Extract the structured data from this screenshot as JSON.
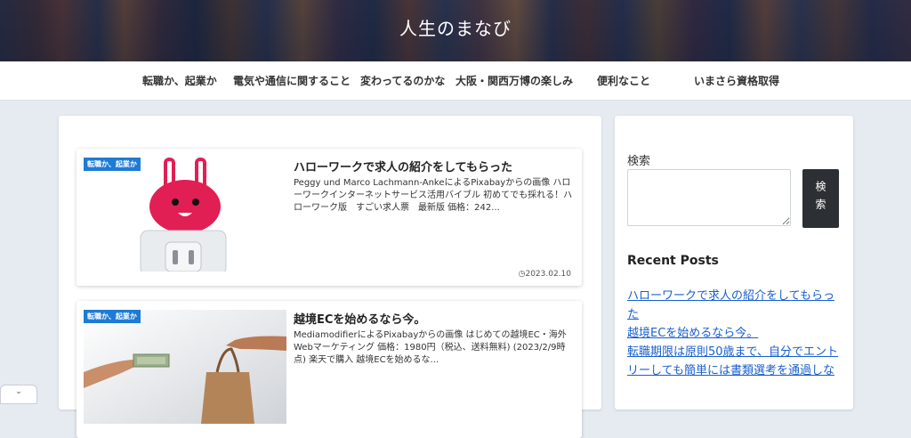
{
  "site": {
    "title": "人生のまなび"
  },
  "nav": {
    "items": [
      {
        "label": "転職か、起業か"
      },
      {
        "label": "電気や通信に関すること"
      },
      {
        "label": "変わってるのかな"
      },
      {
        "label": "大阪・関西万博の楽しみ"
      },
      {
        "label": "便利なこと"
      },
      {
        "label": "いまさら資格取得"
      }
    ]
  },
  "posts": [
    {
      "category": "転職か、起業か",
      "title": "ハローワークで求人の紹介をしてもらった",
      "excerpt": "Peggy und Marco Lachmann-AnkeによるPixabayからの画像 ハローワークインターネットサービス活用バイブル 初めてでも採れる！ハローワーク版　すごい求人票　最新版 価格：242...",
      "date": "2023.02.10",
      "thumb_icon": "rabbit-outlet-icon"
    },
    {
      "category": "転職か、起業か",
      "title": "越境ECを始めるなら今。",
      "excerpt": "MediamodifierによるPixabayからの画像 はじめての越境EC・海外Webマーケティング 価格：1980円（税込、送料無料) (2023/2/9時点) 楽天で購入 越境ECを始めるな...",
      "thumb_icon": "money-bag-exchange-icon"
    }
  ],
  "sidebar": {
    "search": {
      "label": "検索",
      "button": "検索",
      "placeholder": ""
    },
    "recent": {
      "heading": "Recent Posts",
      "items": [
        "ハローワークで求人の紹介をしてもらった",
        "越境ECを始めるなら今。",
        "転職期限は原則50歳まで、自分でエントリーしても簡単には書類選考を通過しな"
      ]
    }
  },
  "colors": {
    "badge": "#1e7bd6",
    "link": "#1a5fcf",
    "search_button": "#2c2f33"
  }
}
